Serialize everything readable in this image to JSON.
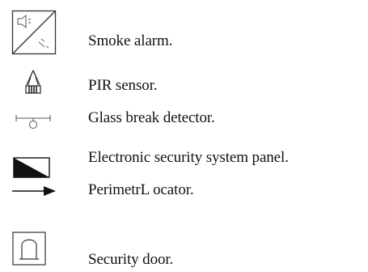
{
  "legend": {
    "items": [
      {
        "icon": "smoke-alarm-icon",
        "label": "Smoke alarm."
      },
      {
        "icon": "pir-sensor-icon",
        "label": "PIR sensor."
      },
      {
        "icon": "glass-break-detector-icon",
        "label": "Glass break detector."
      },
      {
        "icon": "security-panel-icon",
        "label": "Electronic security system panel."
      },
      {
        "icon": "arrow-right-icon",
        "label": "PerimetrL ocator."
      },
      {
        "icon": "security-door-icon",
        "label": "Security door."
      }
    ]
  }
}
